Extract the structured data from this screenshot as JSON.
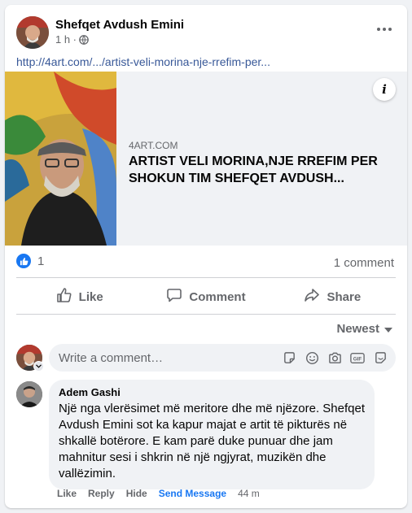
{
  "post": {
    "author": "Shefqet Avdush Emini",
    "time": "1 h ·",
    "link_text": "http://4art.com/.../artist-veli-morina-nje-rrefim-per..."
  },
  "preview": {
    "site": "4ART.COM",
    "title": "ARTIST VELI MORINA,NJE RREFIM PER SHOKUN TIM SHEFQET AVDUSH...",
    "info_label": "i"
  },
  "stats": {
    "likes": "1",
    "comments": "1 comment"
  },
  "actions": {
    "like": "Like",
    "comment": "Comment",
    "share": "Share"
  },
  "sort_label": "Newest",
  "comment_box": {
    "placeholder": "Write a comment…"
  },
  "comment": {
    "author": "Adem Gashi",
    "text": "Një nga vlerësimet më meritore dhe më njëzore. Shefqet Avdush Emini sot ka kapur majat e artit të pikturës në shkallë botërore. E kam parë duke punuar dhe jam mahnitur sesi i shkrin në një ngjyrat, muzikën dhe vallëzimin.",
    "like": "Like",
    "reply": "Reply",
    "hide": "Hide",
    "send_message": "Send Message",
    "time": "44 m"
  },
  "colors": {
    "accent": "#1877f2",
    "link": "#385898",
    "muted": "#65676b",
    "background": "#f0f2f5"
  },
  "icons": [
    "globe-icon",
    "more-icon",
    "info-icon",
    "like-badge-icon",
    "like-icon",
    "comment-icon",
    "share-icon",
    "chevron-down-icon",
    "sticker-icon",
    "emoji-icon",
    "camera-icon",
    "gif-icon",
    "avatar-sticker-icon"
  ]
}
